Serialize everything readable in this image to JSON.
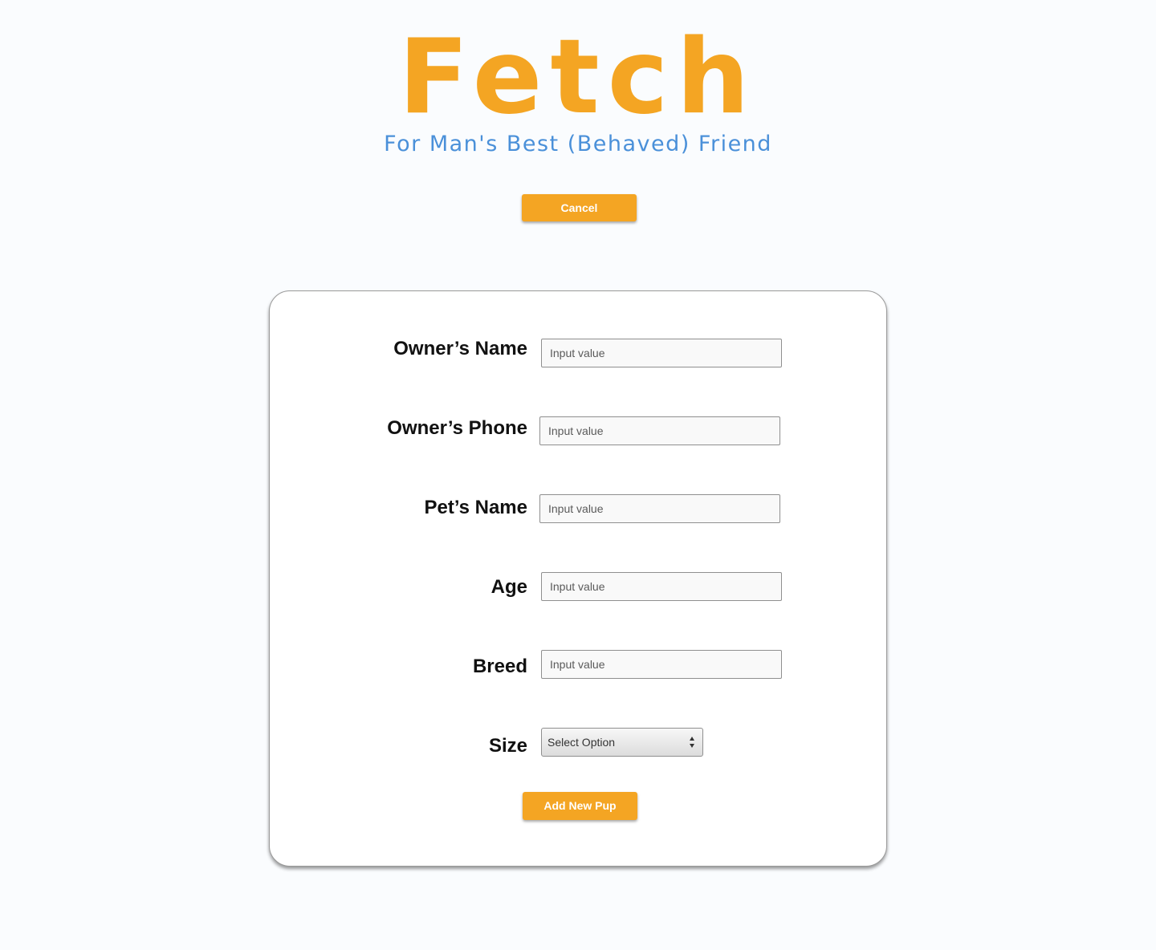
{
  "header": {
    "logo_text": "Fetch",
    "tagline": "For Man's Best (Behaved) Friend"
  },
  "actions": {
    "cancel_label": "Cancel"
  },
  "form": {
    "fields": [
      {
        "label": "Owner’s Name",
        "placeholder": "Input value",
        "value": ""
      },
      {
        "label": "Owner’s Phone",
        "placeholder": "Input value",
        "value": ""
      },
      {
        "label": "Pet’s Name",
        "placeholder": "Input value",
        "value": ""
      },
      {
        "label": "Age",
        "placeholder": "Input value",
        "value": ""
      },
      {
        "label": "Breed",
        "placeholder": "Input value",
        "value": ""
      }
    ],
    "size": {
      "label": "Size",
      "selected": "Select Option",
      "icon": "select-arrows-icon"
    },
    "submit_label": "Add New Pup"
  },
  "colors": {
    "brand_orange": "#f4a523",
    "tagline_blue": "#4a90d9",
    "background": "#fafcfe"
  }
}
